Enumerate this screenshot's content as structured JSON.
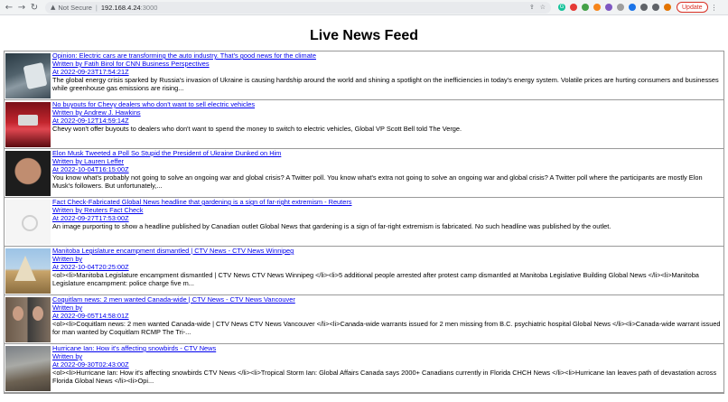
{
  "browser": {
    "security_label": "Not Secure",
    "separator": "|",
    "host": "192.168.4.24",
    "port": ":3000",
    "update_label": "Update"
  },
  "page": {
    "title": "Live News Feed"
  },
  "articles": [
    {
      "headline": "Opinion: Electric cars are transforming the auto industry. That's good news for the climate",
      "byline": "Written by Fatih Birol for CNN Business Perspectives",
      "date": "At 2022-09-23T17:54:21Z",
      "description": "The global energy crisis sparked by Russia's invasion of Ukraine is causing hardship around the world and shining a spotlight on the inefficiencies in today's energy system. Volatile prices are hurting consumers and businesses while greenhouse gas emissions are rising..."
    },
    {
      "headline": "No buyouts for Chevy dealers who don't want to sell electric vehicles",
      "byline": "Written by Andrew J. Hawkins",
      "date": "At 2022-09-12T14:59:14Z",
      "description": "Chevy won't offer buyouts to dealers who don't want to spend the money to switch to electric vehicles, Global VP Scott Bell told The Verge."
    },
    {
      "headline": "Elon Musk Tweeted a Poll So Stupid the President of Ukraine Dunked on Him",
      "byline": "Written by Lauren Leffer",
      "date": "At 2022-10-04T16:15:00Z",
      "description": "You know what's probably not going to solve an ongoing war and global crisis? A Twitter poll. You know what's extra not going to solve an ongoing war and global crisis? A Twitter poll where the participants are mostly Elon Musk's followers. But unfortunately,..."
    },
    {
      "headline": "Fact Check-Fabricated Global News headline that gardening is a sign of far-right extremism - Reuters",
      "byline": "Written by Reuters Fact Check",
      "date": "At 2022-09-27T17:53:00Z",
      "description": "An image purporting to show a headline published by Canadian outlet Global News that gardening is a sign of far-right extremism is fabricated. No such headline was published by the outlet."
    },
    {
      "headline": "Manitoba Legislature encampment dismantled | CTV News - CTV News Winnipeg",
      "byline": "Written by",
      "date": "At 2022-10-04T20:25:00Z",
      "description": "<ol><li>Manitoba Legislature encampment dismantled | CTV News  CTV News Winnipeg </li><li>5 additional people arrested after protest camp dismantled at Manitoba Legislative Building  Global News </li><li>Manitoba Legislature encampment: police charge five m..."
    },
    {
      "headline": "Coquitlam news: 2 men wanted Canada-wide | CTV News - CTV News Vancouver",
      "byline": "Written by",
      "date": "At 2022-09-05T14:58:01Z",
      "description": "<ol><li>Coquitlam news: 2 men wanted Canada-wide | CTV News  CTV News Vancouver </li><li>Canada-wide warrants issued for 2 men missing from B.C. psychiatric hospital  Global News </li><li>Canada-wide warrant issued for man wanted by Coquitlam RCMP  The Tri-..."
    },
    {
      "headline": "Hurricane Ian: How it's affecting snowbirds - CTV News",
      "byline": "Written by",
      "date": "At 2022-09-30T02:43:00Z",
      "description": "<ol><li>Hurricane Ian: How it's affecting snowbirds  CTV News </li><li>Tropical Storm Ian: Global Affairs Canada says 2000+ Canadians currently in Florida  CHCH News </li><li>Hurricane Ian leaves path of devastation across Florida  Global News </li><li>Opi..."
    }
  ]
}
